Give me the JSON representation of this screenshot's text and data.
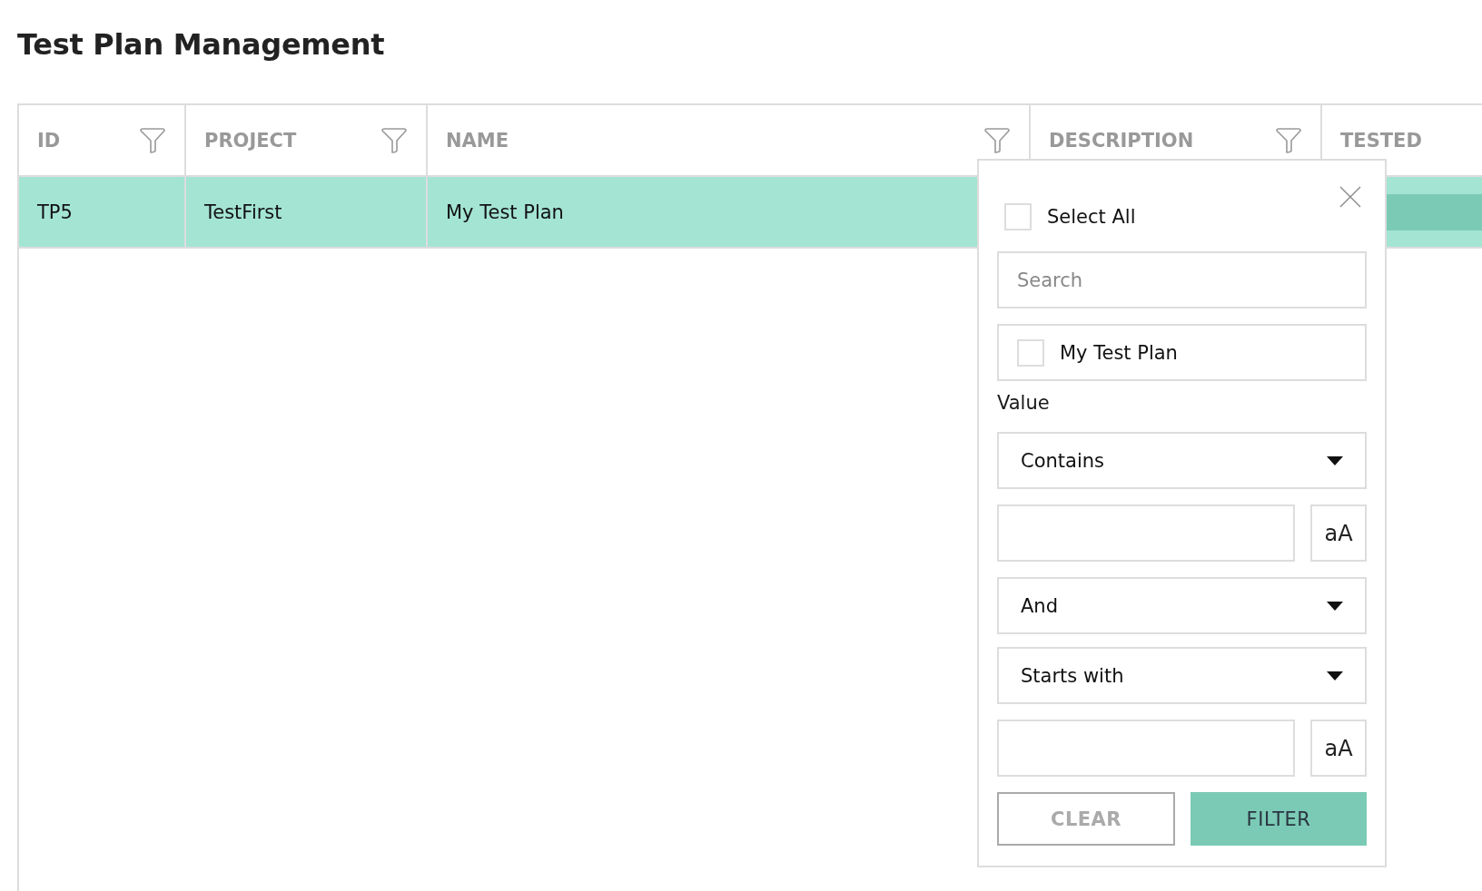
{
  "title": "Test Plan Management",
  "table": {
    "columns": [
      {
        "label": "ID",
        "filterable": true
      },
      {
        "label": "PROJECT",
        "filterable": true
      },
      {
        "label": "NAME",
        "filterable": true
      },
      {
        "label": "DESCRIPTION",
        "filterable": true
      },
      {
        "label": "TESTED",
        "filterable": false
      }
    ],
    "rows": [
      {
        "selected": true,
        "cells": [
          "TP5",
          "TestFirst",
          "My Test Plan"
        ]
      }
    ]
  },
  "filter_popup": {
    "select_all": {
      "label": "Select All",
      "checked": false
    },
    "search": {
      "placeholder": "Search"
    },
    "values": [
      {
        "label": "My Test Plan",
        "checked": false
      }
    ],
    "value_label": "Value",
    "conditions": [
      {
        "kind": "select",
        "value": "Contains"
      },
      {
        "kind": "text",
        "case_button": "aA"
      },
      {
        "kind": "select",
        "value": "And"
      },
      {
        "kind": "select",
        "value": "Starts with"
      },
      {
        "kind": "text",
        "case_button": "aA"
      }
    ],
    "buttons": [
      {
        "label": "CLEAR",
        "kind": "secondary"
      },
      {
        "label": "FILTER",
        "kind": "primary"
      }
    ]
  }
}
